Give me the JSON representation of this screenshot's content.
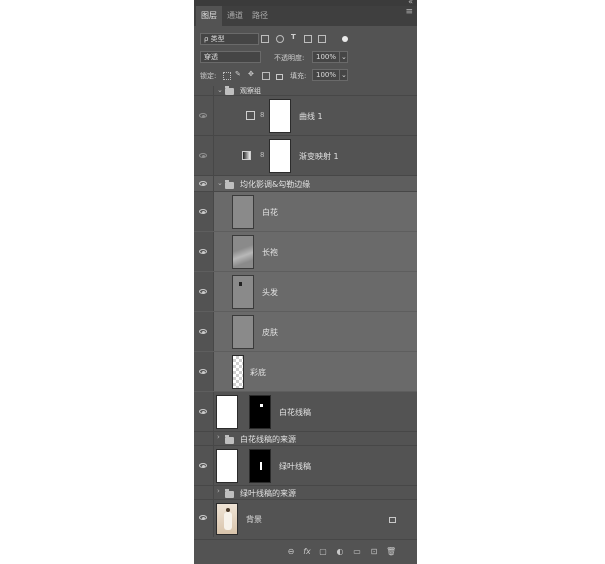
{
  "tabs": [
    "图层",
    "通道",
    "路径"
  ],
  "filter": {
    "kind_label": "ρ 类型",
    "icons": [
      "image-filter-icon",
      "adjustment-filter-icon",
      "type-filter-icon",
      "shape-filter-icon",
      "smart-object-filter-icon",
      "filter-toggle-icon"
    ]
  },
  "blend": {
    "mode": "穿透",
    "opacity_label": "不透明度:",
    "opacity_value": "100%"
  },
  "lock": {
    "label": "锁定:",
    "fill_label": "填充:",
    "fill_value": "100%"
  },
  "layers": [
    {
      "name": "观察组",
      "type": "group",
      "visible": false
    },
    {
      "name": "曲线 1",
      "type": "adjustment",
      "visible": false,
      "adj_icon": "curves-icon"
    },
    {
      "name": "渐变映射 1",
      "type": "adjustment",
      "visible": false,
      "adj_icon": "gradient-map-icon"
    },
    {
      "name": "均化影调&勾勒边缘",
      "type": "group",
      "visible": true
    },
    {
      "name": "白花",
      "type": "layer",
      "visible": true
    },
    {
      "name": "长袍",
      "type": "layer",
      "visible": true
    },
    {
      "name": "头发",
      "type": "layer",
      "visible": true
    },
    {
      "name": "皮肤",
      "type": "layer",
      "visible": true
    },
    {
      "name": "彩底",
      "type": "layer",
      "visible": true
    },
    {
      "name": "白花线稿",
      "type": "masked",
      "visible": true
    },
    {
      "name": "白花线稿的来源",
      "type": "group",
      "visible": false
    },
    {
      "name": "绿叶线稿",
      "type": "masked",
      "visible": true
    },
    {
      "name": "绿叶线稿的来源",
      "type": "group",
      "visible": false
    },
    {
      "name": "背景",
      "type": "background",
      "visible": true
    }
  ],
  "bottom_icons": [
    "link-layers-icon",
    "fx-icon",
    "add-mask-icon",
    "new-adjustment-icon",
    "new-group-icon",
    "new-layer-icon",
    "delete-icon"
  ],
  "bottom_glyphs": [
    "⊖",
    "fx",
    "▢",
    "◐",
    "▭",
    "⊡",
    "🗑"
  ]
}
